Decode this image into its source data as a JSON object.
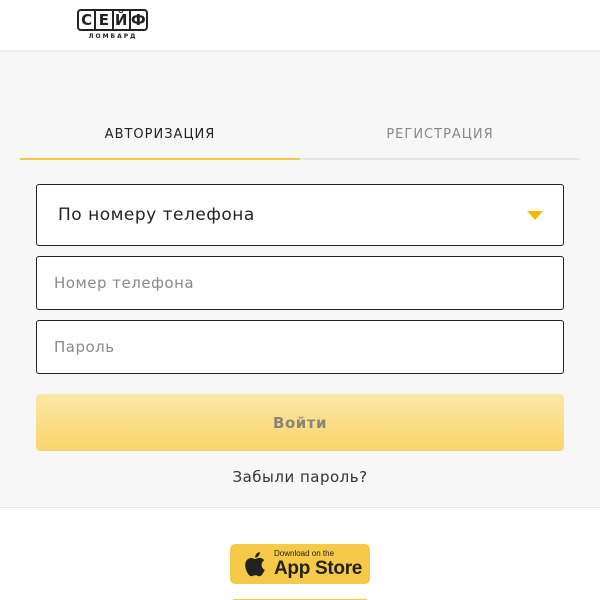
{
  "header": {
    "logo_letters": [
      "С",
      "Е",
      "Й",
      "Ф"
    ],
    "logo_sub": "ЛОМБАРД"
  },
  "tabs": [
    {
      "label": "АВТОРИЗАЦИЯ",
      "active": true
    },
    {
      "label": "РЕГИСТРАЦИЯ",
      "active": false
    }
  ],
  "login_method": {
    "selected": "По номеру телефона"
  },
  "phone_field": {
    "value": "",
    "placeholder": "Номер телефона"
  },
  "password_field": {
    "value": "",
    "placeholder": "Пароль"
  },
  "submit": {
    "label": "Войти"
  },
  "forgot_link": "Забыли пароль?",
  "footer": {
    "appstore_small": "Download on the",
    "appstore_big": "App Store"
  },
  "colors": {
    "accent": "#f5c84a",
    "caret": "#f5b900",
    "button_top": "#fbe8a8",
    "button_bottom": "#f9d56a"
  }
}
